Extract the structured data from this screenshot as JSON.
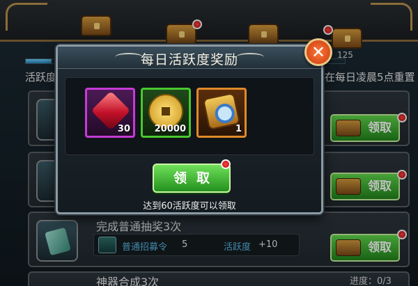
{
  "header": {
    "milestone_value": "125"
  },
  "activity": {
    "label": "活跃度",
    "reset_note": "在每日凌晨5点重置"
  },
  "tasks": [
    {
      "title": "完成普通抽奖3次",
      "item_name": "普通招募令",
      "item_count": "5",
      "activity_label": "活跃度",
      "activity_value": "+10"
    },
    {
      "title": "神器合成3次",
      "progress": "进度：0/3"
    }
  ],
  "side_claim_label": "领取",
  "modal": {
    "title": "每日活跃度奖励",
    "close_label": "✕",
    "rewards": [
      {
        "item": "red-gem",
        "qty": "30",
        "rarity_color": "#c63ad6"
      },
      {
        "item": "gold-coin",
        "qty": "20000",
        "rarity_color": "#49c82e"
      },
      {
        "item": "blue-token",
        "qty": "1",
        "rarity_color": "#e08a2a"
      }
    ],
    "claim_label": "领取",
    "requirement": "达到60活跃度可以领取"
  },
  "colors": {
    "accent_green": "#23901e",
    "close_red": "#c8380c",
    "notice_red": "#b30000"
  }
}
